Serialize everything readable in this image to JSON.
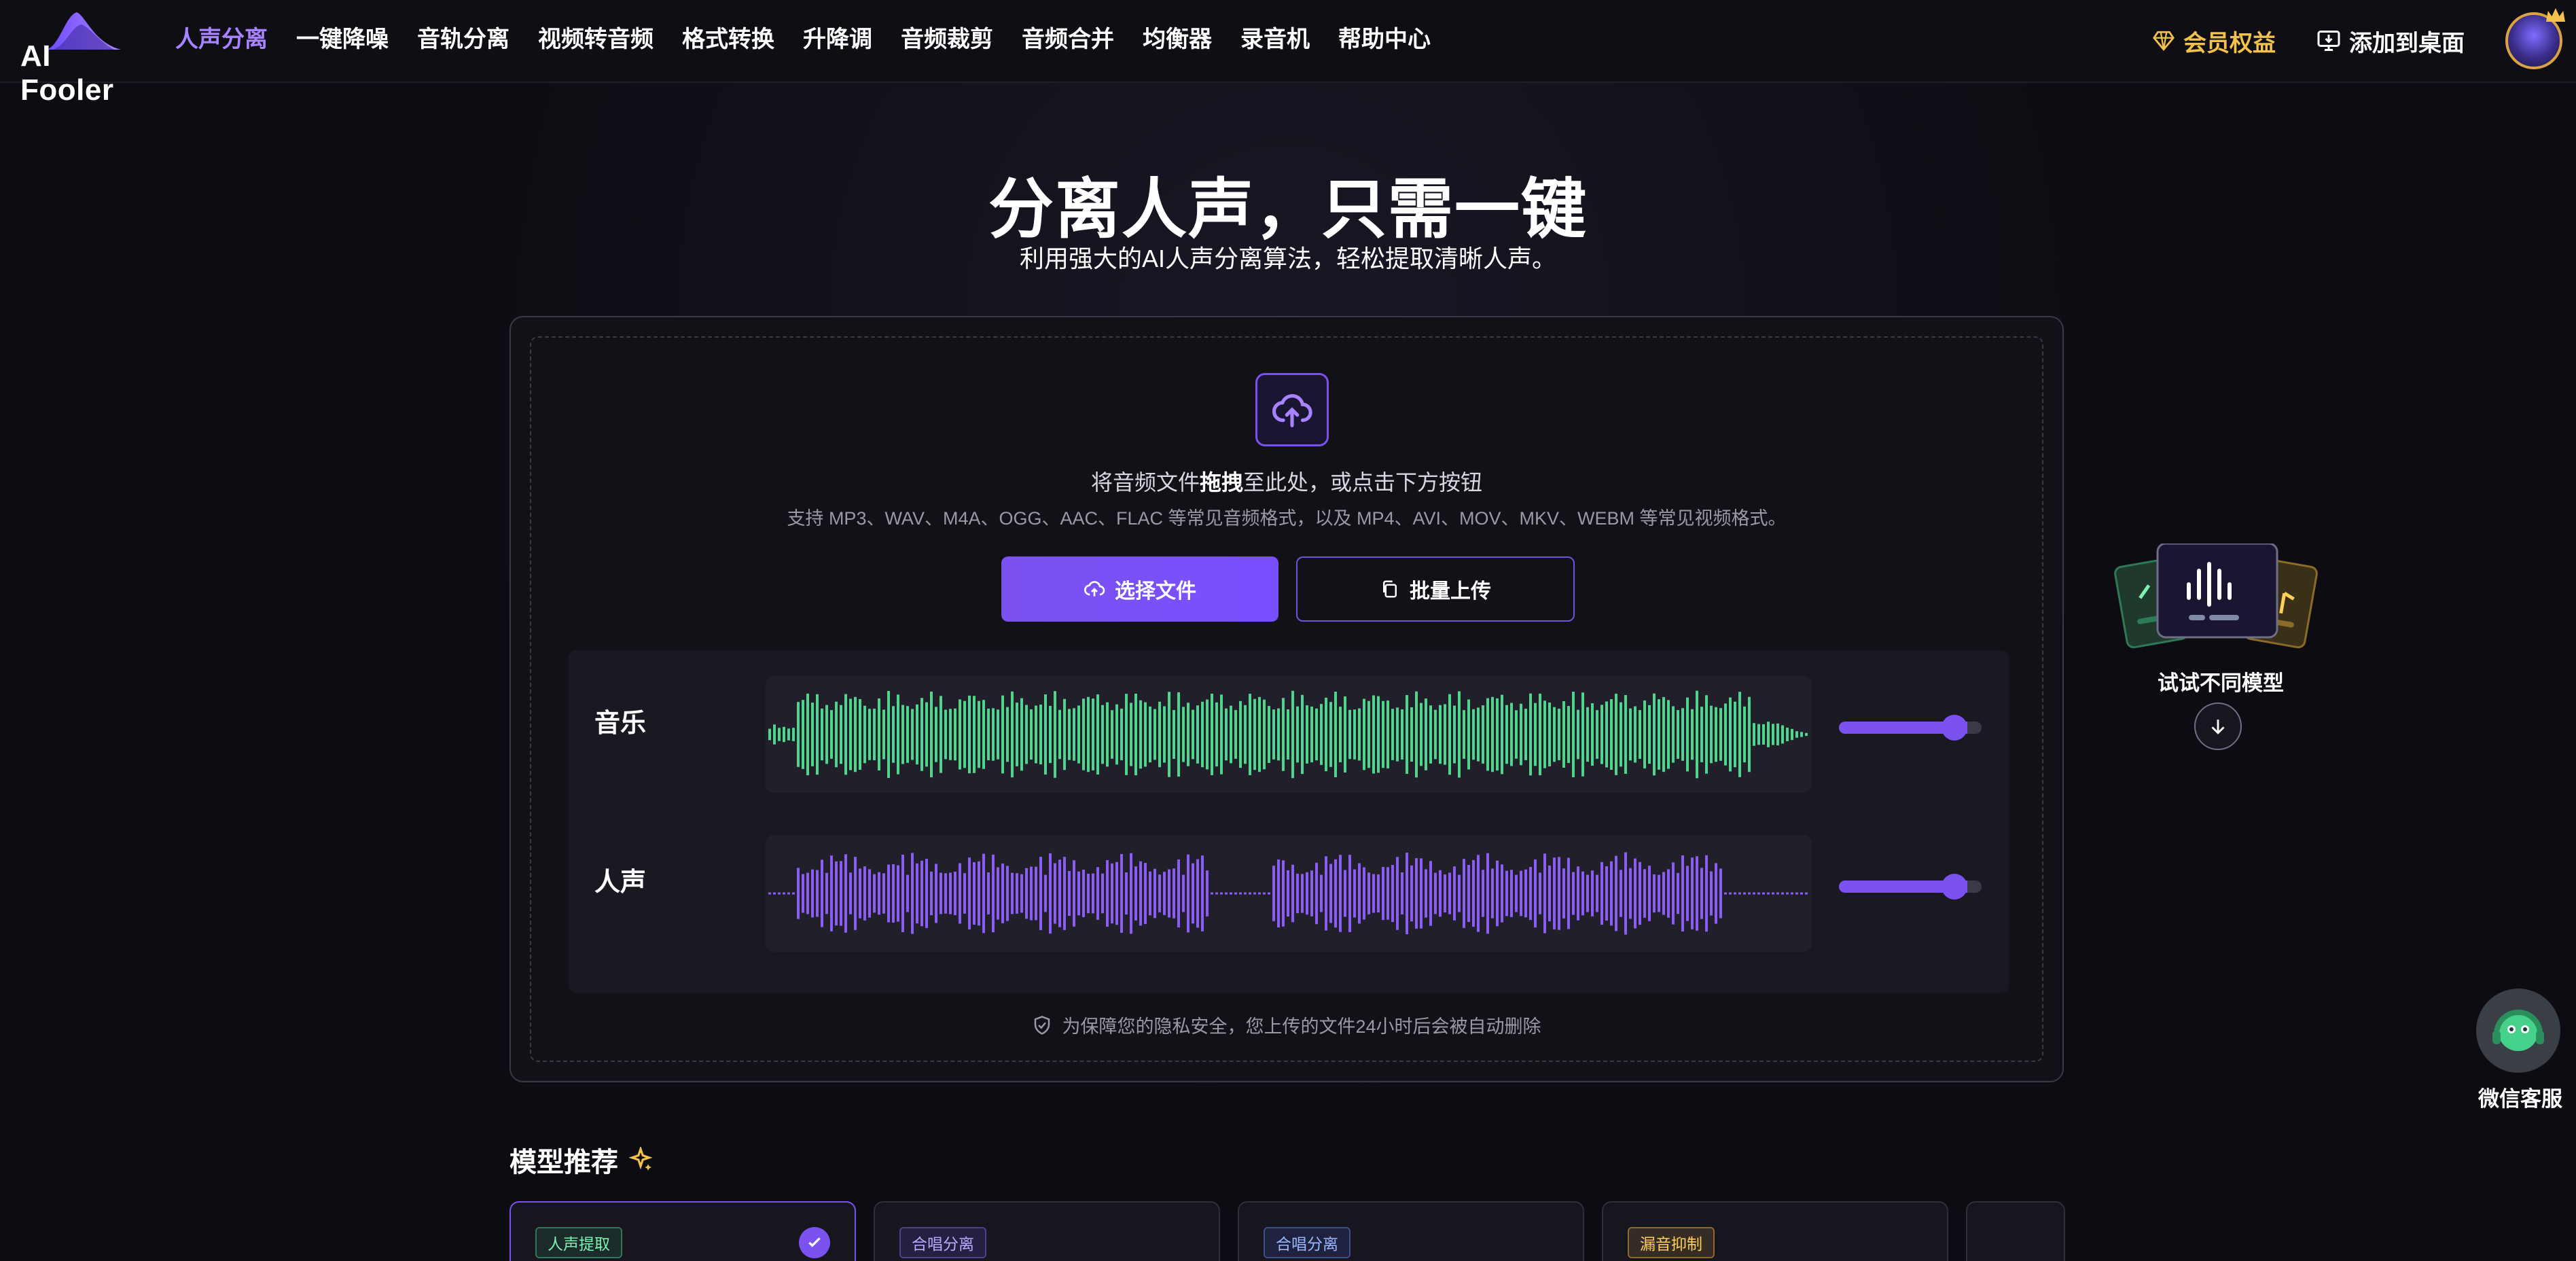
{
  "brand": {
    "name": "AI Fooler"
  },
  "nav": {
    "items": [
      {
        "label": "人声分离",
        "active": true
      },
      {
        "label": "一键降噪"
      },
      {
        "label": "音轨分离"
      },
      {
        "label": "视频转音频"
      },
      {
        "label": "格式转换"
      },
      {
        "label": "升降调"
      },
      {
        "label": "音频裁剪"
      },
      {
        "label": "音频合并"
      },
      {
        "label": "均衡器"
      },
      {
        "label": "录音机"
      },
      {
        "label": "帮助中心"
      }
    ],
    "vip_label": "会员权益",
    "add_desktop_label": "添加到桌面"
  },
  "hero": {
    "title": "分离人声，只需一键",
    "subtitle": "利用强大的AI人声分离算法，轻松提取清晰人声。"
  },
  "upload": {
    "drop_prefix": "将音频文件",
    "drop_bold": "拖拽",
    "drop_suffix": "至此处，或点击下方按钮",
    "formats": "支持 MP3、WAV、M4A、OGG、AAC、FLAC 等常见音频格式，以及 MP4、AVI、MOV、MKV、WEBM 等常见视频格式。",
    "choose_label": "选择文件",
    "batch_label": "批量上传",
    "privacy": "为保障您的隐私安全，您上传的文件24小时后会被自动删除"
  },
  "tracks": [
    {
      "label": "音乐",
      "color": "#4fd58d",
      "volume": 0.9
    },
    {
      "label": "人声",
      "color": "#8b5cf6",
      "volume": 0.9
    }
  ],
  "side": {
    "try_models": "试试不同模型",
    "service": "微信客服"
  },
  "recommend": {
    "title": "模型推荐",
    "cards": [
      {
        "tag": "人声提取",
        "selected": true,
        "tag_color": "green"
      },
      {
        "tag": "合唱分离",
        "tag_color": "purple"
      },
      {
        "tag": "合唱分离",
        "tag_color": "blue"
      },
      {
        "tag": "漏音抑制",
        "tag_color": "gold"
      }
    ]
  },
  "colors": {
    "accent": "#7b51f0",
    "gold": "#f3c24d",
    "music": "#4fd58d",
    "vocal": "#8b5cf6"
  }
}
